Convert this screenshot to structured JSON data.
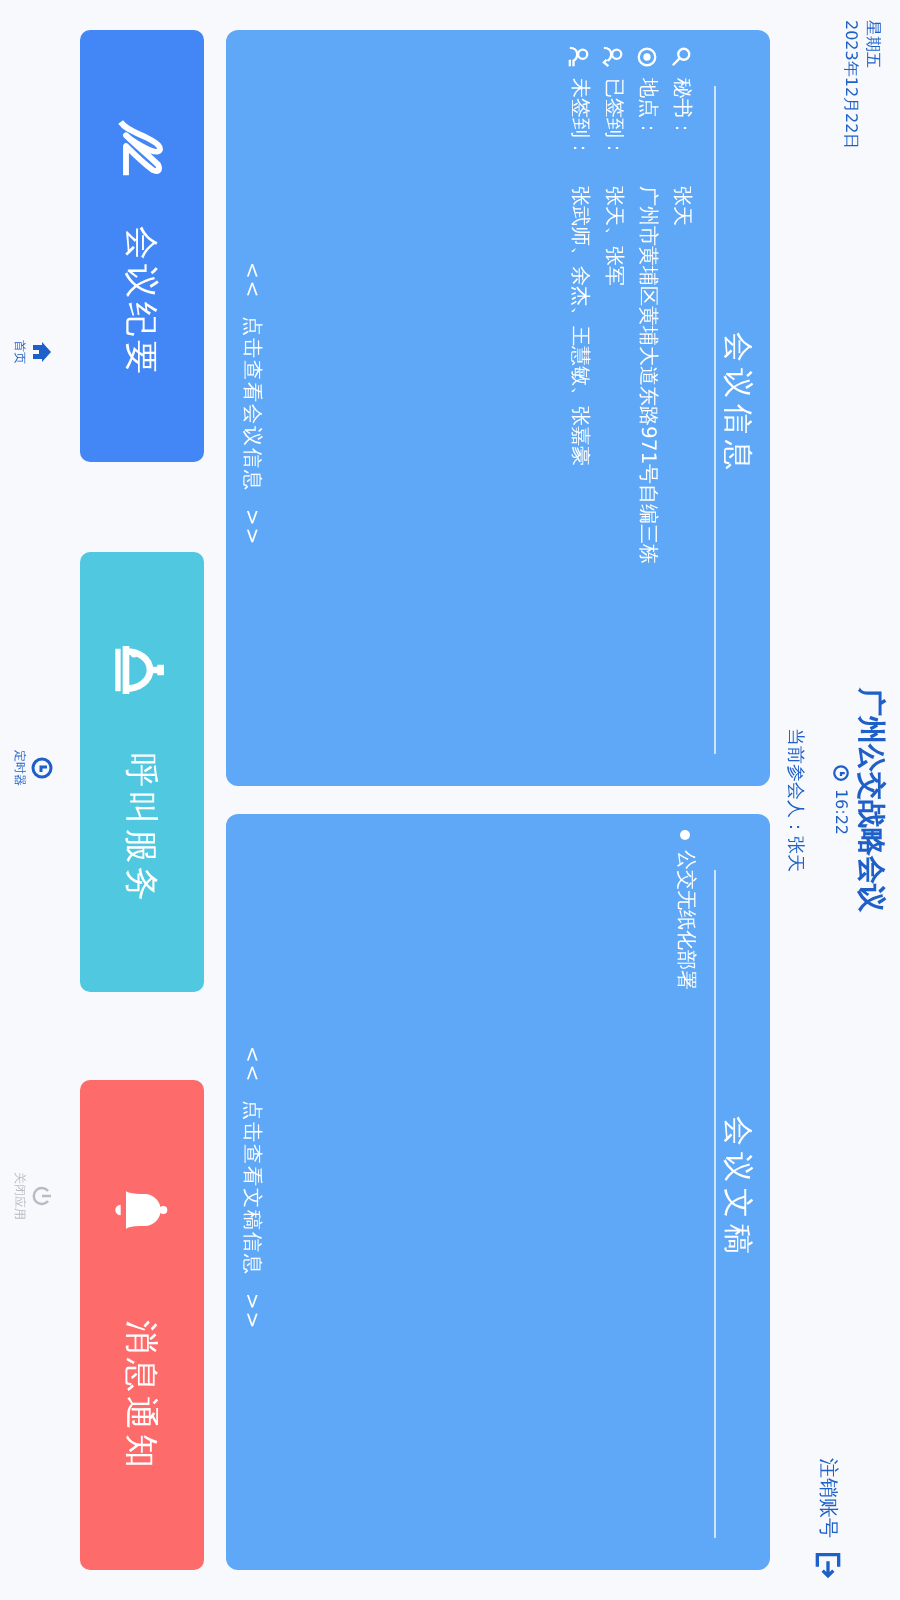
{
  "header": {
    "weekday": "星期五",
    "date": "2023年12月22日",
    "title": "广州公交战略会议",
    "time": "16:22",
    "attendee": "当前参会人：张天",
    "logout": "注销账号"
  },
  "info_card": {
    "title": "会议信息",
    "rows": [
      {
        "kind": "secretary",
        "label": "秘书：",
        "value": "张天"
      },
      {
        "kind": "location",
        "label": "地点：",
        "value": "广州市黄埔区黄埔大道东路971号自编三栋"
      },
      {
        "kind": "signed",
        "label": "已签到：",
        "value": "张天、张军"
      },
      {
        "kind": "unsigned",
        "label": "未签到：",
        "value": "张武师、余杰、王慧敏、张嘉豪"
      }
    ],
    "link": "<<  点击查看会议信息  >>"
  },
  "docs_card": {
    "title": "会议文稿",
    "items": [
      "公交无纸化部署"
    ],
    "link": "<<  点击查看文稿信息  >>"
  },
  "actions": [
    {
      "kind": "minutes",
      "label": "会议纪要",
      "color": "#4386f5"
    },
    {
      "kind": "service",
      "label": "呼叫服务",
      "color": "#4fc8e0"
    },
    {
      "kind": "notice",
      "label": "消息通知",
      "color": "#fe6b6b"
    }
  ],
  "nav": [
    {
      "kind": "home",
      "label": "首页",
      "disabled": false
    },
    {
      "kind": "timer",
      "label": "定时器",
      "disabled": false
    },
    {
      "kind": "power",
      "label": "关闭应用",
      "disabled": true
    }
  ]
}
